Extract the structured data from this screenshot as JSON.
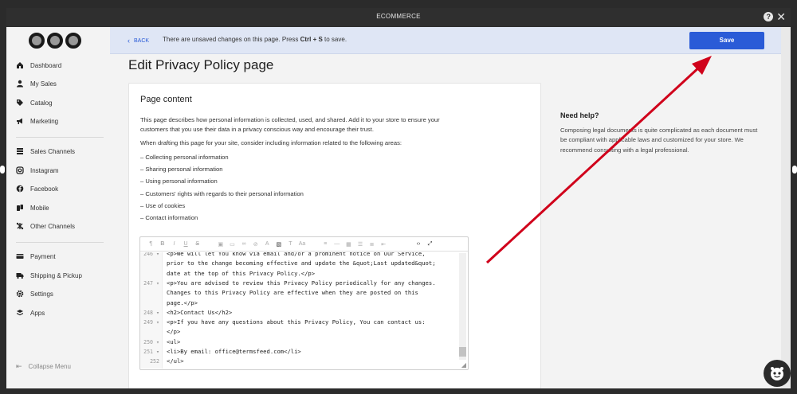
{
  "window": {
    "title": "ECOMMERCE"
  },
  "sidebar": {
    "items": [
      {
        "label": "Dashboard",
        "icon": "home-icon"
      },
      {
        "label": "My Sales",
        "icon": "user-icon"
      },
      {
        "label": "Catalog",
        "icon": "tag-icon"
      },
      {
        "label": "Marketing",
        "icon": "megaphone-icon"
      },
      {
        "label": "Sales Channels",
        "icon": "layers-icon"
      },
      {
        "label": "Instagram",
        "icon": "instagram-icon"
      },
      {
        "label": "Facebook",
        "icon": "facebook-icon"
      },
      {
        "label": "Mobile",
        "icon": "mobile-icon"
      },
      {
        "label": "Other Channels",
        "icon": "network-icon"
      },
      {
        "label": "Payment",
        "icon": "card-icon"
      },
      {
        "label": "Shipping & Pickup",
        "icon": "truck-icon"
      },
      {
        "label": "Settings",
        "icon": "gear-icon"
      },
      {
        "label": "Apps",
        "icon": "apps-icon"
      }
    ],
    "collapse_label": "Collapse Menu"
  },
  "notice": {
    "back_label": "BACK",
    "text_before": "There are unsaved changes on this page. Press ",
    "shortcut": "Ctrl + S",
    "text_after": " to save.",
    "save_label": "Save"
  },
  "page": {
    "title": "Edit Privacy Policy page",
    "card_title": "Page content",
    "intro": "This page describes how personal information is collected, used, and shared. Add it to your store to ensure your customers that you use their data in a privacy conscious way and encourage their trust.",
    "drafting": "When drafting this page for your site, consider including information related to the following areas:",
    "areas": [
      "Collecting personal information",
      "Sharing personal information",
      "Using personal information",
      "Customers' rights with regards to their personal information",
      "Use of cookies",
      "Contact information"
    ]
  },
  "editor": {
    "lines": [
      {
        "num": "246",
        "fold": "▾",
        "text": "<p>We will let You know via email and/or a prominent notice on Our Service,"
      },
      {
        "num": "",
        "fold": "",
        "text": "prior to the change becoming effective and update the &quot;Last updated&quot;"
      },
      {
        "num": "",
        "fold": "",
        "text": "date at the top of this Privacy Policy.</p>"
      },
      {
        "num": "247",
        "fold": "▾",
        "text": "<p>You are advised to review this Privacy Policy periodically for any changes."
      },
      {
        "num": "",
        "fold": "",
        "text": "Changes to this Privacy Policy are effective when they are posted on this"
      },
      {
        "num": "",
        "fold": "",
        "text": "page.</p>"
      },
      {
        "num": "248",
        "fold": "▾",
        "text": "<h2>Contact Us</h2>"
      },
      {
        "num": "249",
        "fold": "▾",
        "text": "<p>If you have any questions about this Privacy Policy, You can contact us:"
      },
      {
        "num": "",
        "fold": "",
        "text": "</p>"
      },
      {
        "num": "250",
        "fold": "▾",
        "text": "<ul>"
      },
      {
        "num": "251",
        "fold": "▾",
        "text": "<li>By email: office@termsfeed.com</li>"
      },
      {
        "num": "252",
        "fold": "",
        "text": "</ul>"
      }
    ]
  },
  "help": {
    "title": "Need help?",
    "text": "Composing legal documents is quite complicated as each document must be compliant with applicable laws and customized for your store. We recommend consulting with a legal professional."
  },
  "colors": {
    "accent": "#2a5bd7",
    "notice_bg": "#dfe6f5",
    "annotation_arrow": "#d0021b"
  }
}
